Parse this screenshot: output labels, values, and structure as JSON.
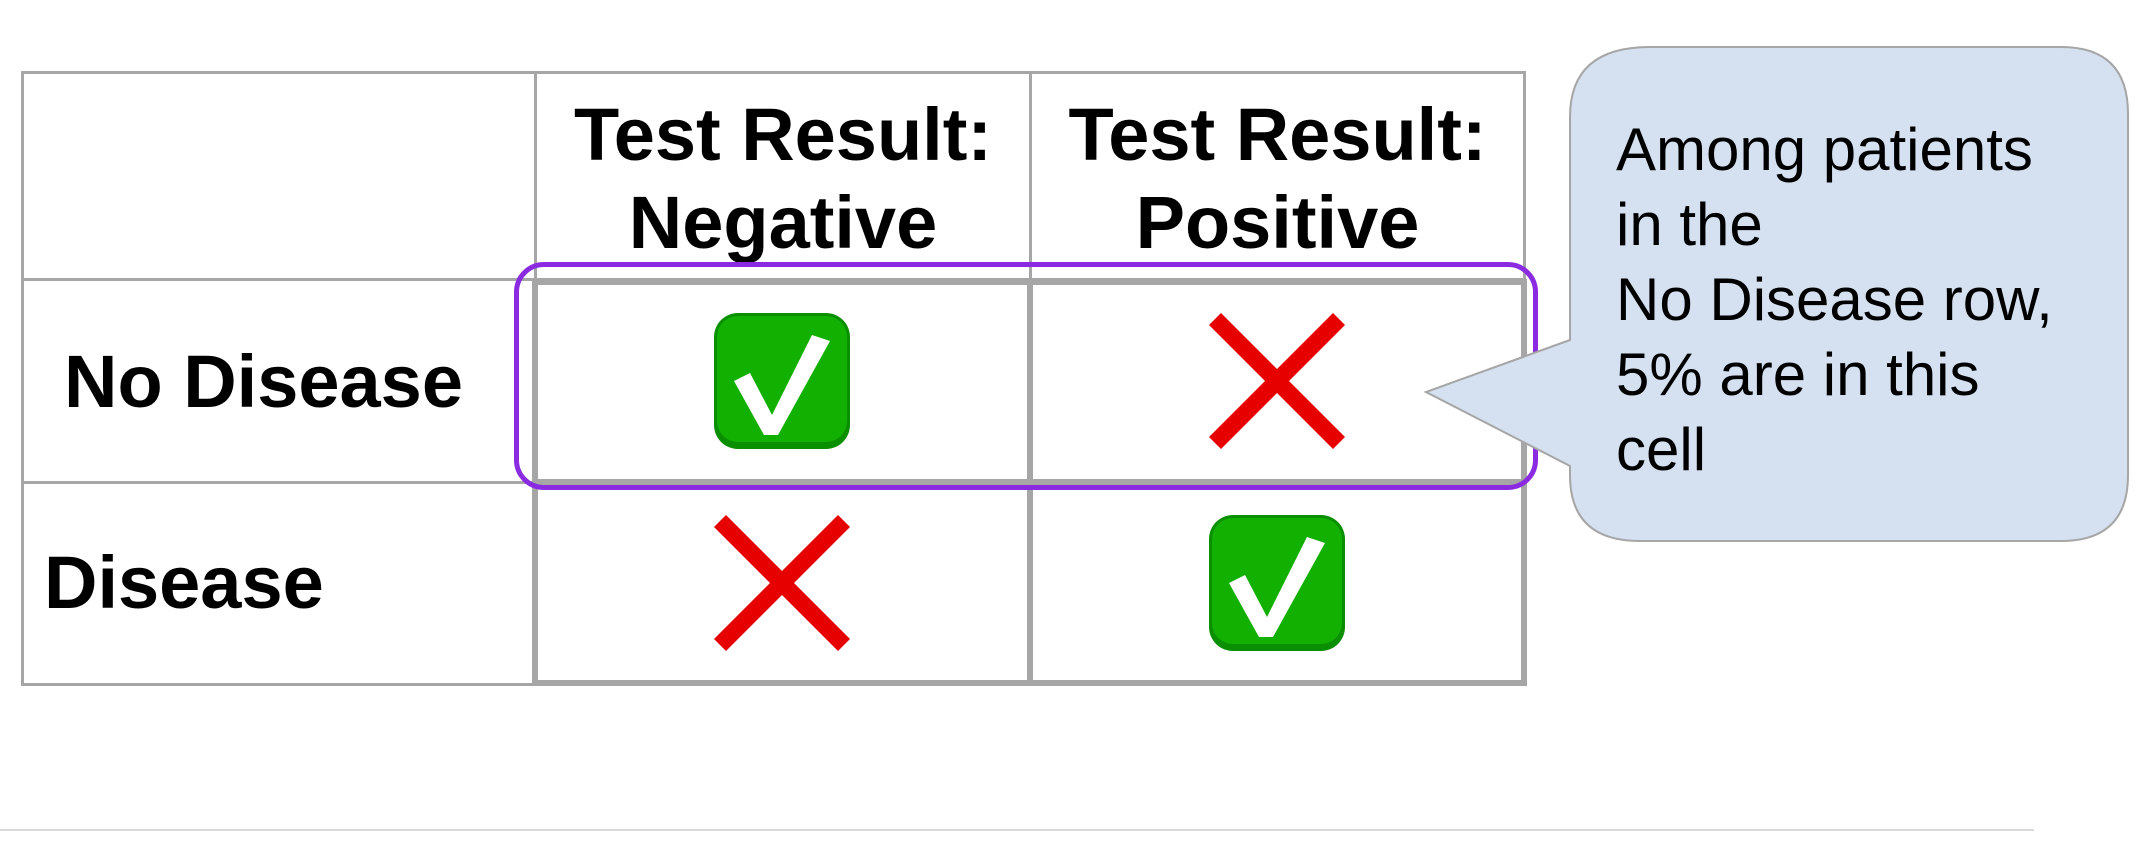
{
  "table": {
    "columns": [
      "Test Result:\nNegative",
      "Test Result:\nPositive"
    ],
    "rows": [
      {
        "label": "No Disease",
        "cells": [
          "check-icon",
          "cross-icon"
        ]
      },
      {
        "label": "Disease",
        "cells": [
          "cross-icon",
          "check-icon"
        ]
      }
    ]
  },
  "callout": {
    "text": "Among patients\nin the\nNo Disease row,\n5% are in this\ncell"
  },
  "colors": {
    "highlight": "#8a2be2",
    "callout_fill": "#d5e1f0",
    "check_green": "#12b000",
    "cross_red": "#e60000",
    "grid": "#a6a6a6"
  }
}
